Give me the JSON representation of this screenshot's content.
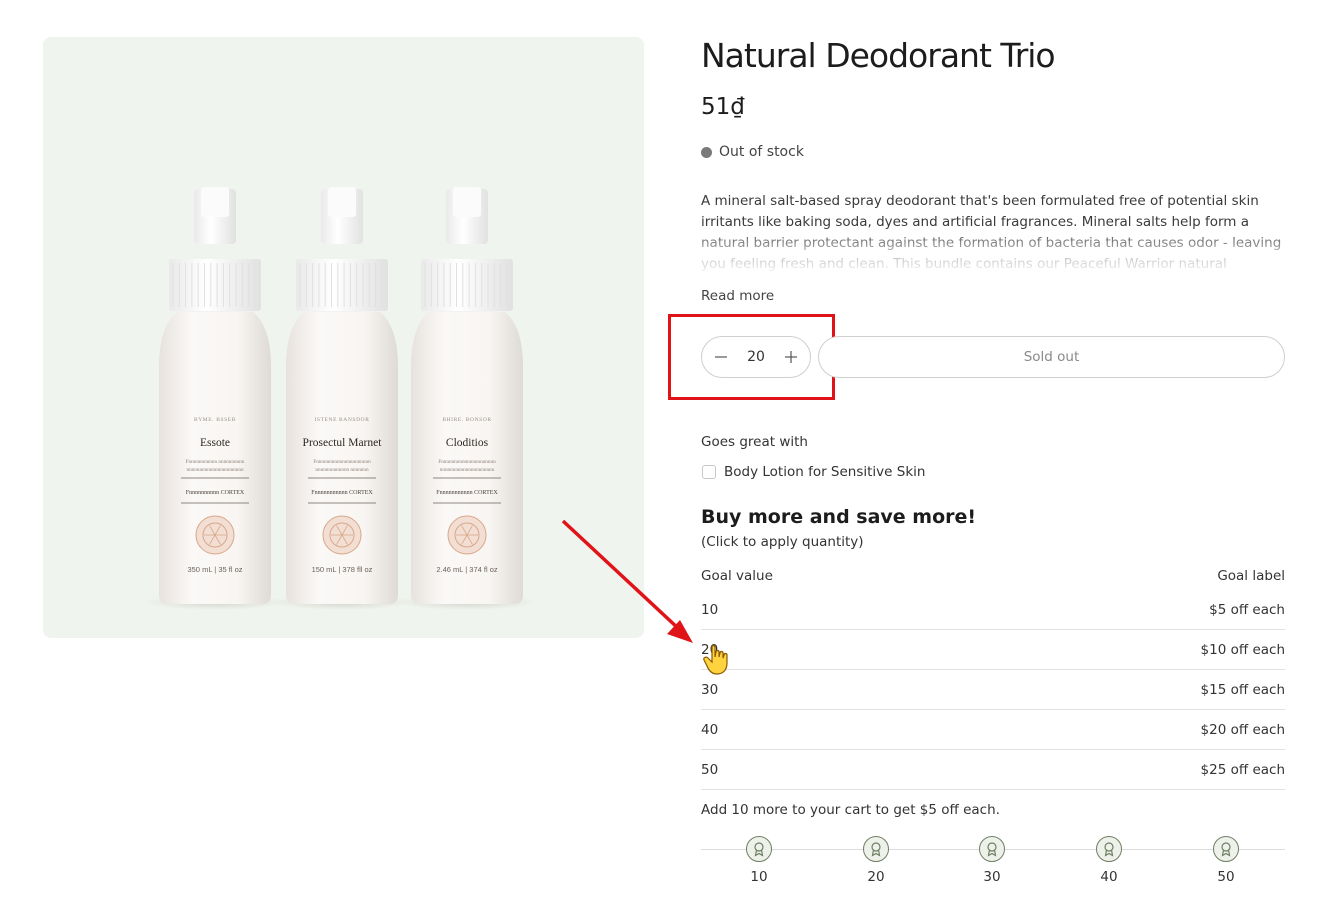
{
  "product": {
    "title": "Natural Deodorant Trio",
    "price": "51₫",
    "stock_status": "Out of stock",
    "description": "A mineral salt-based spray deodorant that's been formulated free of potential skin irritants like baking soda, dyes and artificial fragrances. Mineral salts help form a natural barrier protectant against the formation of bacteria that causes odor - leaving you feeling fresh and clean. This bundle contains our Peaceful Warrior natural deodorant spray.",
    "read_more": "Read more",
    "image_alt": "Three white spray deodorant bottles",
    "bottles": [
      {
        "brand": "BYME. BSSEB",
        "name": "Essote",
        "desc1": "Fnnnnnnnnnnn nnnnnnnnnn",
        "desc2": "nnnnnnnnnnnnnnnnnnnnnn",
        "sub": "Fnnnnnnnnnn CORTEX",
        "size": "350 mL | 35 fl oz"
      },
      {
        "brand": "ISTENE BANSDOR",
        "name": "Prosectul Marnet",
        "desc1": "Fnnnnnnnnnnnnnnnnnnnnn",
        "desc2": "nnnnnnnnnnnnn nnnnnnn",
        "sub": "Fnnnnnnnnnnn CORTEX",
        "size": "150 mL | 378 fll oz"
      },
      {
        "brand": "BHIRE. BONSOR",
        "name": "Cloditios",
        "desc1": "Fnnnnnnnnnnnnnnnnnnnnn",
        "desc2": "nnnnnnnnnnnnnnnnnnnnn",
        "sub": "Fnnnnnnnnnnn CORTEX",
        "size": "2.46 mL | 374 fl oz"
      }
    ]
  },
  "quantity": {
    "value": "20"
  },
  "buttons": {
    "sold_out": "Sold out"
  },
  "upsell": {
    "heading": "Goes great with",
    "item_label": "Body Lotion for Sensitive Skin"
  },
  "volume_discount": {
    "title": "Buy more and save more!",
    "subtitle": "(Click to apply quantity)",
    "col_value": "Goal value",
    "col_label": "Goal label",
    "rows": [
      {
        "value": "10",
        "label": "$5 off each"
      },
      {
        "value": "20",
        "label": "$10 off each"
      },
      {
        "value": "30",
        "label": "$15 off each"
      },
      {
        "value": "40",
        "label": "$20 off each"
      },
      {
        "value": "50",
        "label": "$25 off each"
      }
    ],
    "progress_message": "Add 10 more to your cart to get $5 off each.",
    "milestones": [
      "10",
      "20",
      "30",
      "40",
      "50"
    ],
    "milestone_icon": "award-icon"
  },
  "colors": {
    "annotation_red": "#e01418",
    "image_bg": "#f0f4ee",
    "milestone_border": "#6f7f63"
  }
}
